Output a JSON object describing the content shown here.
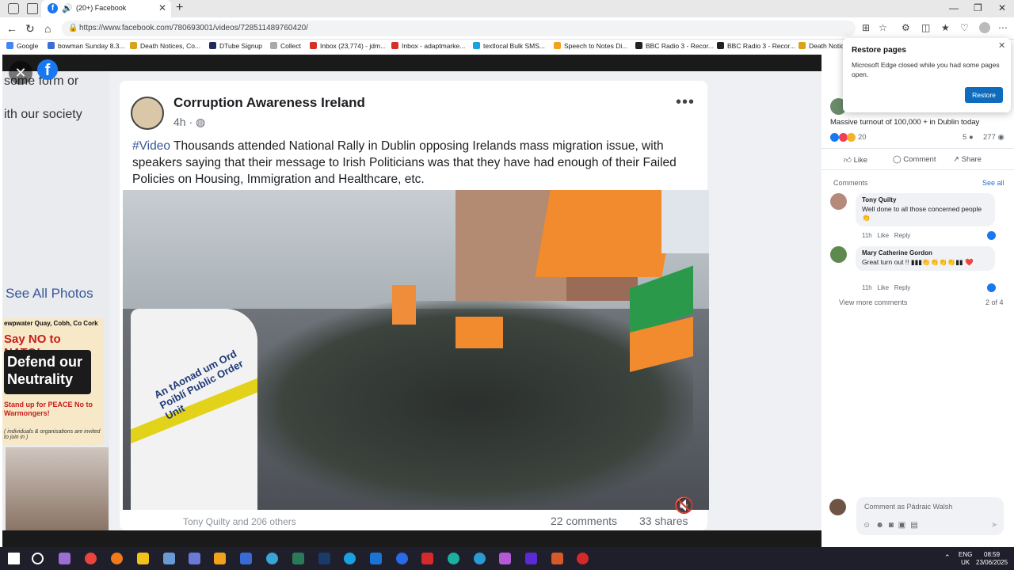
{
  "browser": {
    "tab_title": "(20+) Facebook",
    "url": "https://www.facebook.com/780693001/videos/728511489760420/",
    "bookmarks": [
      {
        "label": "Google",
        "color": "#4285f4"
      },
      {
        "label": "bowman Sunday 8.3...",
        "color": "#3b6ed4"
      },
      {
        "label": "Death Notices, Co...",
        "color": "#d9a21b"
      },
      {
        "label": "DTube Signup",
        "color": "#1e2a5a"
      },
      {
        "label": "Collect",
        "color": "#aaaaaa"
      },
      {
        "label": "Inbox (23,774) - jdm...",
        "color": "#d93025"
      },
      {
        "label": "Inbox - adaptmarke...",
        "color": "#d93025"
      },
      {
        "label": "textlocal Bulk SMS...",
        "color": "#1aa1e0"
      },
      {
        "label": "Speech to Notes Di...",
        "color": "#f4a21b"
      },
      {
        "label": "BBC Radio 3 - Recor...",
        "color": "#222222"
      },
      {
        "label": "BBC Radio 3 - Recor...",
        "color": "#222222"
      },
      {
        "label": "Death Notic",
        "color": "#d9a21b"
      }
    ]
  },
  "restore_popup": {
    "title": "Restore pages",
    "message": "Microsoft Edge closed while you had some pages open.",
    "button": "Restore"
  },
  "viewer": {
    "left_panel": {
      "text1": "some form or",
      "text2": "ith our society",
      "see_all_photos": "See All Photos",
      "poster_line1": "ewpwater Quay, Cobh, Co Cork",
      "poster_line2": "Say NO to NATO!",
      "poster_line3": "Defend our Neutrality",
      "poster_line4": "Stand up for PEACE No to Warmongers!",
      "poster_line5": "( individuals & organisations are invited to join in )"
    },
    "post": {
      "page_name": "Corruption Awareness Ireland",
      "time": "4h · ◍",
      "hashtag": "#Video",
      "text": " Thousands attended National Rally in Dublin opposing Irelands mass migration issue, with speakers saying that their message to Irish Politicians was that they have had enough of their Failed Policies on Housing, Immigration and Healthcare, etc.",
      "van_text": "An tAonad um Ord Poiblí Public Order Unit",
      "likers": "Tony Quilty and 206 others",
      "comments": "22 comments",
      "shares": "33 shares"
    }
  },
  "sidebar": {
    "caption": "Massive turnout of 100,000 + in Dublin today",
    "reaction_count": "20",
    "comment_count": "5",
    "view_count": "277",
    "actions": {
      "like": "Like",
      "comment": "Comment",
      "share": "Share"
    },
    "comments_heading": "Comments",
    "see_all": "See all",
    "comments": [
      {
        "name": "Tony Quilty",
        "text": "Well done to all those concerned people 👏",
        "time": "11h",
        "like": "Like",
        "reply": "Reply"
      },
      {
        "name": "Mary Catherine Gordon",
        "text": "Great turn out !! ▮▮▮👏👏👏👏▮▮ ❤️",
        "time": "11h",
        "like": "Like",
        "reply": "Reply"
      }
    ],
    "view_more": "View more comments",
    "pagination": "2 of 4",
    "compose_placeholder": "Comment as Pádraic Walsh"
  },
  "taskbar": {
    "lang": "ENG",
    "region": "UK",
    "time": "08:59",
    "date": "23/06/2025"
  }
}
